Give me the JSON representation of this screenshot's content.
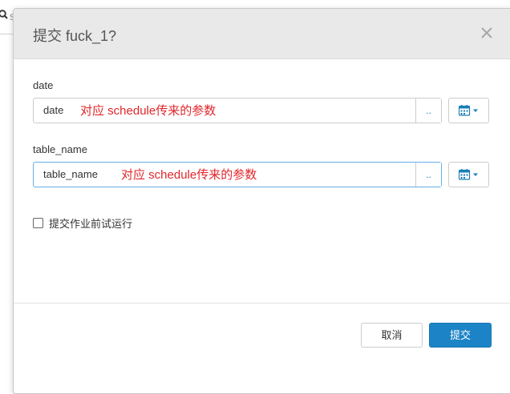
{
  "background": {
    "search_icon": "magnifier-icon",
    "search_text": "s"
  },
  "dialog": {
    "title": "提交 fuck_1?",
    "close_icon": "close-icon",
    "fields": [
      {
        "label": "date",
        "value": "date",
        "annotation": "对应 schedule传来的参数",
        "addon_label": "..",
        "calendar_icon": "calendar-icon"
      },
      {
        "label": "table_name",
        "value": "table_name",
        "annotation": "对应 schedule传来的参数",
        "addon_label": "..",
        "calendar_icon": "calendar-icon"
      }
    ],
    "checkbox": {
      "label": "提交作业前试运行",
      "checked": false
    },
    "buttons": {
      "cancel": "取消",
      "submit": "提交"
    }
  },
  "colors": {
    "annotation": "#e0262b",
    "primary": "#1c84c6",
    "link": "#1a7fb5",
    "focus_border": "#66afe9"
  }
}
